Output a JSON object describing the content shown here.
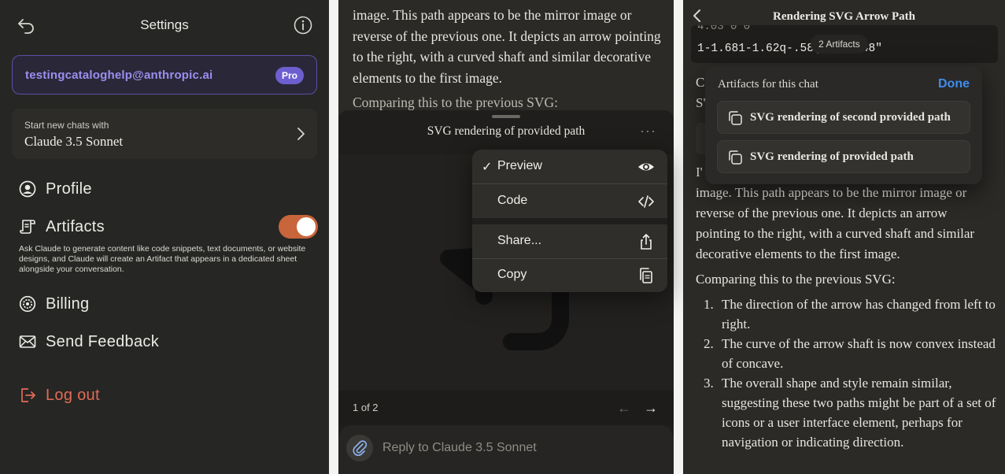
{
  "settings": {
    "title": "Settings",
    "email": "testingcataloghelp@anthropic.ai",
    "plan_badge": "Pro",
    "model_hint": "Start new chats with",
    "model_name": "Claude 3.5 Sonnet",
    "items": [
      {
        "label": "Profile",
        "icon": "user-circle-icon"
      },
      {
        "label": "Artifacts",
        "icon": "artifacts-icon"
      },
      {
        "label": "Billing",
        "icon": "gear-icon"
      },
      {
        "label": "Send Feedback",
        "icon": "mail-icon"
      }
    ],
    "artifacts_enabled": true,
    "artifacts_description": "Ask Claude to generate content like code snippets, text documents, or website designs, and Claude will create an Artifact that appears in a dedicated sheet alongside your conversation.",
    "logout_label": "Log out",
    "accent_color": "#c8653b",
    "logout_color": "#e26b57"
  },
  "artifact_sheet": {
    "chat_text": "image. This path appears to be the mirror image or reverse of the previous one. It depicts an arrow pointing to the right, with a curved shaft and similar decorative elements to the first image.",
    "chat_compare": "Comparing this to the previous SVG:",
    "title": "SVG rendering of provided path",
    "more": "···",
    "page_count": "1 of 2",
    "prev_arrow": "←",
    "next_arrow": "→",
    "reply_placeholder": "Reply to Claude 3.5 Sonnet",
    "menu": {
      "preview": "Preview",
      "preview_check": "✓",
      "code": "Code",
      "share": "Share...",
      "copy": "Copy"
    }
  },
  "chat_view": {
    "title": "Rendering SVG Arrow Path",
    "code_line1": "4.03 0 0",
    "code_line2": "1-1.681-1.62q-.58( 3-2.448\"",
    "artifacts_pill": "2 Artifacts",
    "partial_c": "C",
    "partial_s": "S'",
    "partial_i": "I'",
    "body": "image. This path appears to be the mirror image or reverse of the previous one. It depicts an arrow pointing to the right, with a curved shaft and similar decorative elements to the first image.",
    "compare": "Comparing this to the previous SVG:",
    "list": [
      {
        "num": "1.",
        "text": "The direction of the arrow has changed from left to right."
      },
      {
        "num": "2.",
        "text": "The curve of the arrow shaft is now convex instead of concave."
      },
      {
        "num": "3.",
        "text": "The overall shape and style remain similar, suggesting these two paths might be part of a set of icons or a user interface element, perhaps for navigation or indicating direction."
      }
    ],
    "popup": {
      "title": "Artifacts for this chat",
      "done": "Done",
      "items": [
        "SVG rendering of second provided path",
        "SVG rendering of provided path"
      ]
    }
  }
}
